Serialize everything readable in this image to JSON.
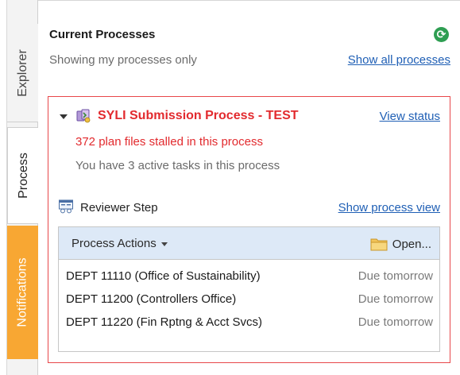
{
  "side_tabs": {
    "explorer": "Explorer",
    "process": "Process",
    "notifications": "Notifications"
  },
  "header": {
    "title": "Current Processes",
    "subtitle": "Showing my processes only",
    "show_all_link": "Show all processes",
    "refresh_icon": "refresh-icon"
  },
  "process": {
    "name": "SYLI Submission Process - TEST",
    "view_status_link": "View status",
    "stalled_text": "372 plan files stalled in this process",
    "active_tasks_text": "You have 3 active tasks in this process",
    "step_label": "Reviewer Step",
    "show_process_view_link": "Show process view",
    "actions_label": "Process Actions",
    "open_label": "Open...",
    "tasks": [
      {
        "name": "DEPT 11110 (Office of Sustainability)",
        "due": "Due tomorrow"
      },
      {
        "name": "DEPT 11200 (Controllers Office)",
        "due": "Due tomorrow"
      },
      {
        "name": "DEPT 11220 (Fin Rptng & Acct Svcs)",
        "due": "Due tomorrow"
      }
    ]
  },
  "colors": {
    "accent_red": "#e22a2e",
    "link_blue": "#1f5fb5",
    "notifications_orange": "#f8a733",
    "refresh_green": "#2e9e52",
    "actions_bar_bg": "#dde9f7"
  }
}
